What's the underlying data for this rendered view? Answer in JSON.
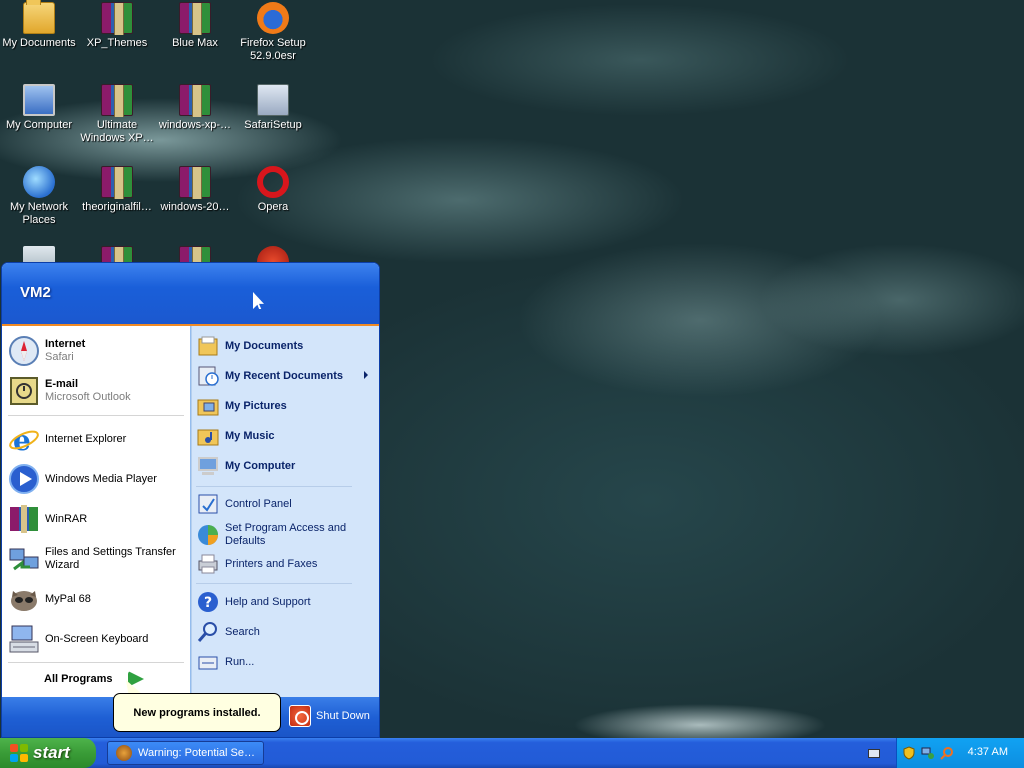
{
  "desktop": {
    "icons": [
      {
        "label": "My Documents",
        "icon": "my-documents-icon"
      },
      {
        "label": "XP_Themes",
        "icon": "winrar-archive-icon"
      },
      {
        "label": "Blue Max",
        "icon": "winrar-archive-icon"
      },
      {
        "label": "Firefox Setup 52.9.0esr",
        "icon": "firefox-setup-icon"
      },
      {
        "label": "My Computer",
        "icon": "my-computer-icon"
      },
      {
        "label": "Ultimate Windows XP…",
        "icon": "winrar-archive-icon"
      },
      {
        "label": "windows-xp-…",
        "icon": "winrar-archive-icon"
      },
      {
        "label": "SafariSetup",
        "icon": "safari-setup-icon"
      },
      {
        "label": "My Network Places",
        "icon": "network-places-icon"
      },
      {
        "label": "theoriginalfil…",
        "icon": "winrar-archive-icon"
      },
      {
        "label": "windows-20…",
        "icon": "winrar-archive-icon"
      },
      {
        "label": "Opera",
        "icon": "opera-icon"
      }
    ]
  },
  "start_menu": {
    "user": "VM2",
    "pinned": [
      {
        "title": "Internet",
        "subtitle": "Safari",
        "icon": "safari-icon"
      },
      {
        "title": "E-mail",
        "subtitle": "Microsoft Outlook",
        "icon": "outlook-icon"
      }
    ],
    "recent": [
      {
        "title": "Internet Explorer",
        "icon": "internet-explorer-icon"
      },
      {
        "title": "Windows Media Player",
        "icon": "media-player-icon"
      },
      {
        "title": "WinRAR",
        "icon": "winrar-icon"
      },
      {
        "title": "Files and Settings Transfer Wizard",
        "icon": "transfer-wizard-icon"
      },
      {
        "title": "MyPal 68",
        "icon": "mypal-icon"
      },
      {
        "title": "On-Screen Keyboard",
        "icon": "keyboard-icon"
      }
    ],
    "all_programs": "All Programs",
    "places": [
      {
        "label": "My Documents",
        "bold": true,
        "icon": "my-documents-icon"
      },
      {
        "label": "My Recent Documents",
        "bold": true,
        "icon": "recent-documents-icon"
      },
      {
        "label": "My Pictures",
        "bold": true,
        "icon": "my-pictures-icon"
      },
      {
        "label": "My Music",
        "bold": true,
        "icon": "my-music-icon"
      },
      {
        "label": "My Computer",
        "bold": true,
        "icon": "my-computer-icon"
      },
      {
        "label": "Control Panel",
        "bold": false,
        "icon": "control-panel-icon"
      },
      {
        "label": "Set Program Access and Defaults",
        "bold": false,
        "icon": "program-access-icon"
      },
      {
        "label": "Printers and Faxes",
        "bold": false,
        "icon": "printer-icon"
      },
      {
        "label": "Help and Support",
        "bold": false,
        "icon": "help-icon"
      },
      {
        "label": "Search",
        "bold": false,
        "icon": "search-icon"
      },
      {
        "label": "Run...",
        "bold": false,
        "icon": "run-icon"
      }
    ],
    "shut_down": "Shut Down"
  },
  "balloon": {
    "text": "New programs installed."
  },
  "taskbar": {
    "start_label": "start",
    "task_item": "Warning: Potential Se…",
    "clock": "4:37 AM"
  },
  "colors": {
    "start_green": "#3a9c37",
    "taskbar_blue": "#245edb",
    "tray_blue": "#0c8ee0",
    "header_orange": "#f08a24"
  }
}
